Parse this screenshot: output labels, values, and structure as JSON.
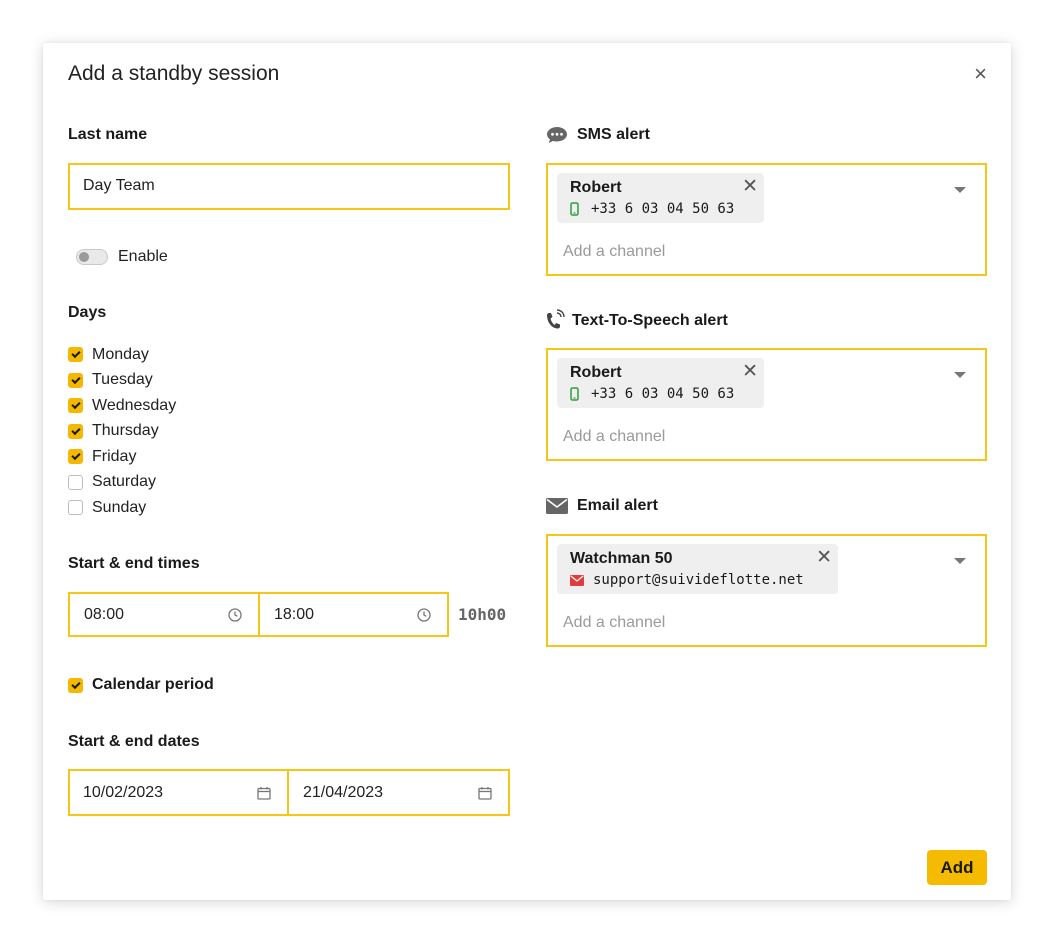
{
  "modal": {
    "title": "Add a standby session",
    "close_glyph": "×"
  },
  "last_name": {
    "label": "Last name",
    "value": "Day Team"
  },
  "enable": {
    "label": "Enable",
    "checked": false
  },
  "days": {
    "label": "Days",
    "items": [
      {
        "label": "Monday",
        "checked": true
      },
      {
        "label": "Tuesday",
        "checked": true
      },
      {
        "label": "Wednesday",
        "checked": true
      },
      {
        "label": "Thursday",
        "checked": true
      },
      {
        "label": "Friday",
        "checked": true
      },
      {
        "label": "Saturday",
        "checked": false
      },
      {
        "label": "Sunday",
        "checked": false
      }
    ]
  },
  "times": {
    "label": "Start & end times",
    "start": "08:00",
    "end": "18:00",
    "duration": "10h00",
    "icon": "clock-icon"
  },
  "calendar_period": {
    "label": "Calendar period",
    "checked": true
  },
  "dates": {
    "label": "Start & end dates",
    "start": "10/02/2023",
    "end": "21/04/2023",
    "icon": "calendar-icon"
  },
  "sms": {
    "label": "SMS alert",
    "icon": "chat-bubble-icon",
    "chip": {
      "name": "Robert",
      "value": "+33 6 03 04 50 63",
      "icon": "mobile-phone-icon"
    },
    "placeholder": "Add a channel"
  },
  "tts": {
    "label": "Text-To-Speech alert",
    "icon": "phone-ringing-icon",
    "chip": {
      "name": "Robert",
      "value": "+33 6 03 04 50 63",
      "icon": "mobile-phone-icon"
    },
    "placeholder": "Add a channel"
  },
  "email": {
    "label": "Email alert",
    "icon": "envelope-icon",
    "chip": {
      "name": "Watchman 50",
      "value": "support@suivideflotte.net",
      "icon": "envelope-icon"
    },
    "placeholder": "Add a channel"
  },
  "chip_remove_glyph": "✕",
  "footer": {
    "add_label": "Add"
  },
  "colors": {
    "accent": "#f5bb00",
    "input_border": "#f5c518",
    "mobile_icon": "#2e9e3e",
    "email_chip_icon": "#e03e3e",
    "placeholder": "#9a9a9a"
  }
}
